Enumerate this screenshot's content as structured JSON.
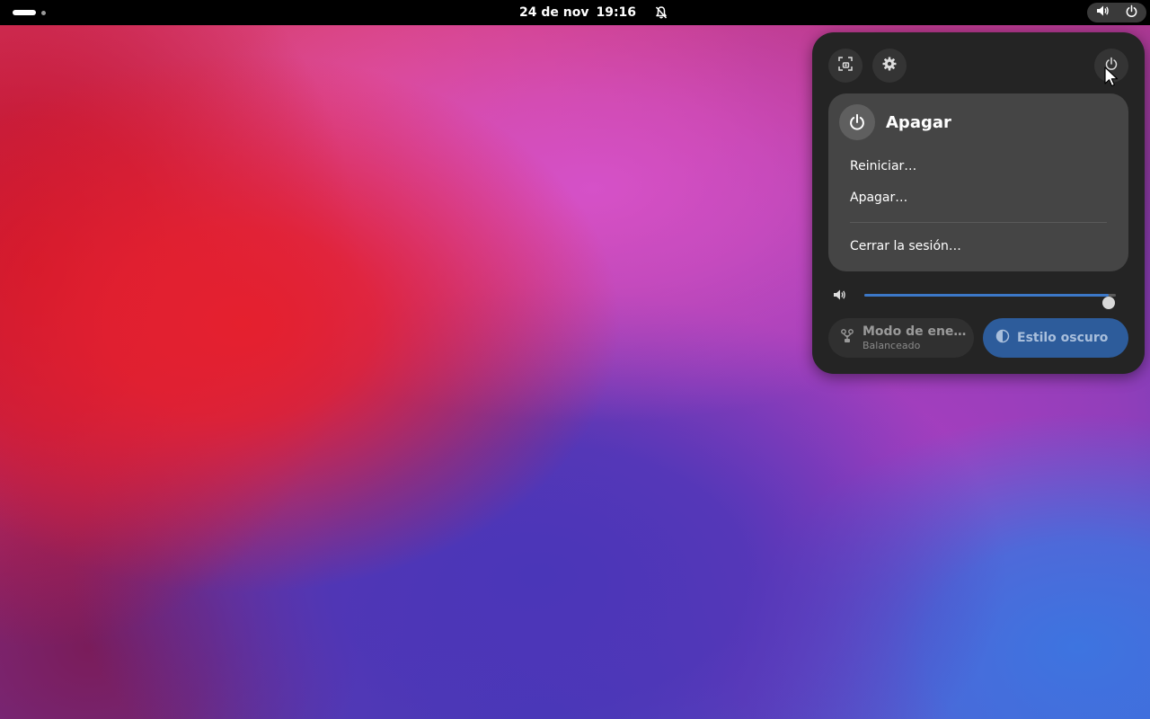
{
  "topbar": {
    "date": "24 de nov",
    "time": "19:16",
    "icons": {
      "activities": "workspace-indicator",
      "notifications": "bell-off-icon",
      "volume": "speaker-icon",
      "power": "power-icon"
    }
  },
  "quick_settings": {
    "top_buttons": [
      "screenshot-icon",
      "gear-icon",
      "power-icon"
    ],
    "power_menu": {
      "title": "Apagar",
      "items": [
        {
          "label": "Reiniciar…"
        },
        {
          "label": "Apagar…"
        },
        {
          "label": "Cerrar la sesión…"
        }
      ]
    },
    "volume": {
      "level": 1.0
    },
    "toggles": {
      "power_mode": {
        "title": "Modo de ene…",
        "subtitle": "Balanceado",
        "active": false
      },
      "dark_style": {
        "title": "Estilo oscuro",
        "active": true
      }
    }
  },
  "colors": {
    "panel_bg": "#242424",
    "submenu_bg": "#454545",
    "accent": "#3c78c8",
    "toggle_active": "#2d5c9b"
  }
}
